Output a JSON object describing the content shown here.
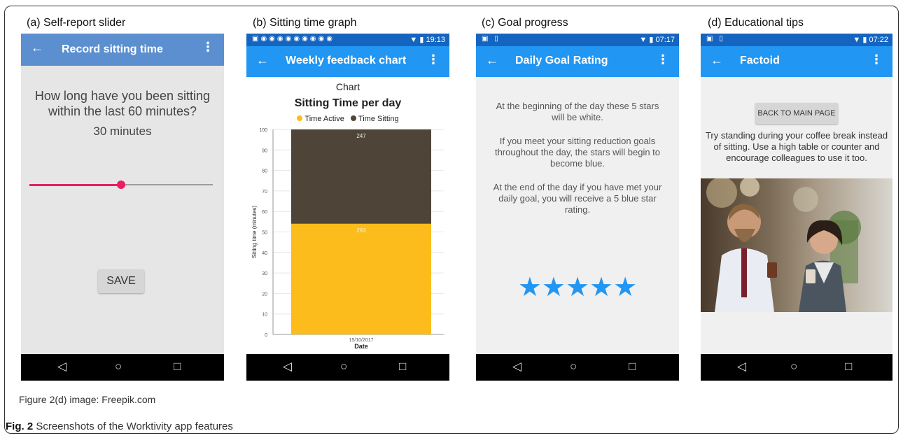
{
  "panels": {
    "a": {
      "label": "(a) Self-report slider",
      "app_title": "Record sitting time",
      "question": "How long have you been sitting within the last 60 minutes?",
      "value": "30 minutes",
      "slider_fraction": 0.5,
      "save_label": "SAVE"
    },
    "b": {
      "label": "(b) Sitting time graph",
      "status_time": "19:13",
      "app_title": "Weekly feedback chart",
      "chart_heading": "Chart"
    },
    "c": {
      "label": "(c) Goal progress",
      "status_time": "07:17",
      "app_title": "Daily Goal Rating",
      "paragraphs": [
        "At the beginning of the day these 5 stars will be white.",
        "If you meet your sitting reduction goals throughout the day, the stars will begin to become blue.",
        "At the end of the day if you have met your daily goal, you will receive a 5 blue star rating."
      ],
      "stars": "★★★★★",
      "star_count": 5
    },
    "d": {
      "label": "(d) Educational tips",
      "status_time": "07:22",
      "app_title": "Factoid",
      "button_label": "BACK TO MAIN PAGE",
      "tip": "Try standing during your coffee break instead of sitting. Use a high table or counter and encourage colleagues to use it too."
    }
  },
  "icons": {
    "back": "←",
    "menu": "⋮",
    "nav_back": "◁",
    "nav_home": "○",
    "nav_recent": "□"
  },
  "chart_data": {
    "type": "bar",
    "title": "Sitting Time per day",
    "xlabel": "Date",
    "ylabel": "Sitting time (minutes)",
    "categories": [
      "15/10/2017"
    ],
    "ylim": [
      0,
      100
    ],
    "yticks": [
      0,
      10,
      20,
      30,
      40,
      50,
      60,
      70,
      80,
      90,
      100
    ],
    "stacked": true,
    "legend_position": "top",
    "series": [
      {
        "name": "Time Active",
        "values": [
          54
        ],
        "label": "293",
        "color": "#fbbc1c"
      },
      {
        "name": "Time Sitting",
        "values": [
          46
        ],
        "label": "247",
        "color": "#4e4538"
      }
    ]
  },
  "credit": "Figure 2(d) image: Freepik.com",
  "caption": {
    "prefix": "Fig. 2",
    "text": " Screenshots of the Worktivity app features"
  }
}
